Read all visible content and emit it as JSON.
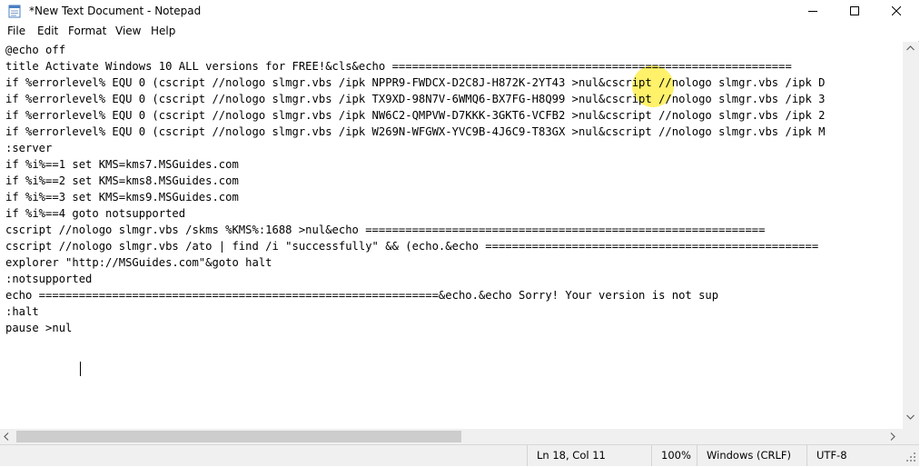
{
  "window": {
    "title": "*New Text Document - Notepad",
    "controls": {
      "minimize": "minimize",
      "maximize": "maximize",
      "close": "close"
    }
  },
  "menu": [
    "File",
    "Edit",
    "Format",
    "View",
    "Help"
  ],
  "editor": {
    "lines": [
      "@echo off",
      "title Activate Windows 10 ALL versions for FREE!&cls&echo ============================================================",
      "if %errorlevel% EQU 0 (cscript //nologo slmgr.vbs /ipk NPPR9-FWDCX-D2C8J-H872K-2YT43 >nul&cscript //nologo slmgr.vbs /ipk D",
      "if %errorlevel% EQU 0 (cscript //nologo slmgr.vbs /ipk TX9XD-98N7V-6WMQ6-BX7FG-H8Q99 >nul&cscript //nologo slmgr.vbs /ipk 3",
      "if %errorlevel% EQU 0 (cscript //nologo slmgr.vbs /ipk NW6C2-QMPVW-D7KKK-3GKT6-VCFB2 >nul&cscript //nologo slmgr.vbs /ipk 2",
      "if %errorlevel% EQU 0 (cscript //nologo slmgr.vbs /ipk W269N-WFGWX-YVC9B-4J6C9-T83GX >nul&cscript //nologo slmgr.vbs /ipk M",
      ":server",
      "if %i%==1 set KMS=kms7.MSGuides.com",
      "if %i%==2 set KMS=kms8.MSGuides.com",
      "if %i%==3 set KMS=kms9.MSGuides.com",
      "if %i%==4 goto notsupported",
      "cscript //nologo slmgr.vbs /skms %KMS%:1688 >nul&echo ============================================================",
      "cscript //nologo slmgr.vbs /ato | find /i \"successfully\" && (echo.&echo ==================================================",
      "explorer \"http://MSGuides.com\"&goto halt",
      ":notsupported",
      "echo ============================================================&echo.&echo Sorry! Your version is not sup",
      ":halt",
      "pause >nul"
    ]
  },
  "statusbar": {
    "position": "Ln 18, Col 11",
    "zoom": "100%",
    "line_ending": "Windows (CRLF)",
    "encoding": "UTF-8"
  }
}
